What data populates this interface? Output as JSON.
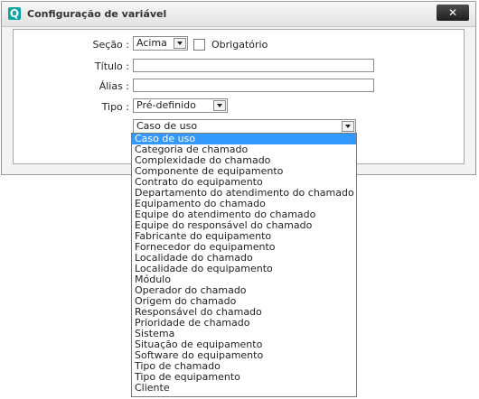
{
  "dialog": {
    "title": "Configuração de variável",
    "close_label": "✕"
  },
  "form": {
    "secao_label": "Seção :",
    "secao_value": "Acima",
    "obrigatorio_label": "Obrigatório",
    "obrigatorio_checked": false,
    "titulo_label": "Título :",
    "titulo_value": "",
    "alias_label": "Álias :",
    "alias_value": "",
    "tipo_label": "Tipo :",
    "tipo_value": "Pré-definido",
    "list_value": "Caso de uso"
  },
  "dropdown": {
    "options": [
      "Caso de uso",
      "Categoria de chamado",
      "Complexidade do chamado",
      "Componente de equipamento",
      "Contrato do equipamento",
      "Departamento do atendimento do chamado",
      "Equipamento do chamado",
      "Equipe do atendimento do chamado",
      "Equipe do responsável do chamado",
      "Fabricante do equipamento",
      "Fornecedor do equipamento",
      "Localidade do chamado",
      "Localidade do equipamento",
      "Módulo",
      "Operador do chamado",
      "Origem do chamado",
      "Responsável do chamado",
      "Prioridade de chamado",
      "Sistema",
      "Situação de equipamento",
      "Software do equipamento",
      "Tipo de chamado",
      "Tipo de equipamento",
      "Cliente"
    ],
    "selected_index": 0
  }
}
